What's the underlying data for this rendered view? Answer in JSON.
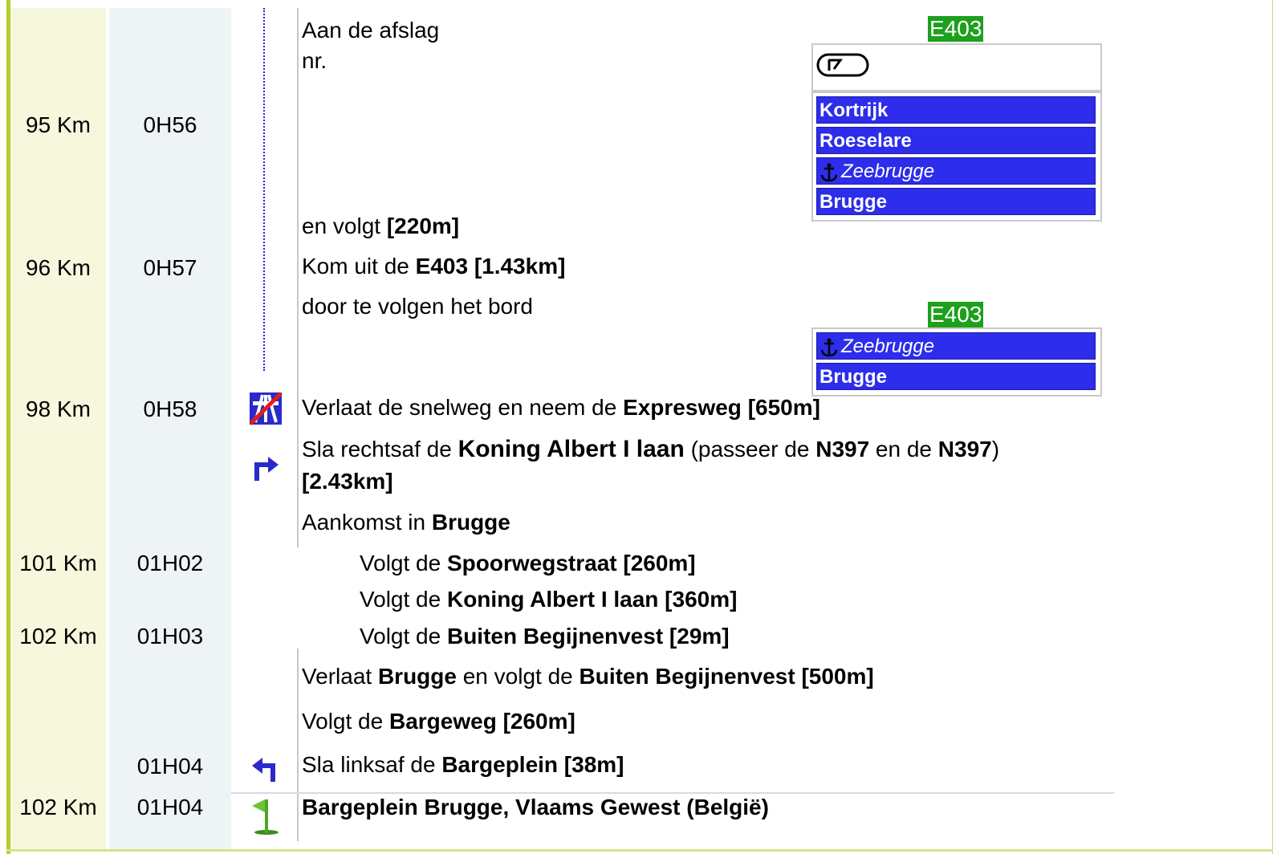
{
  "rows": {
    "r1": {
      "text1": "Aan de afslag",
      "text2": "nr.",
      "km": "95 Km",
      "time": "0H56"
    },
    "r2": {
      "prefix": "en volgt ",
      "bold": "[220m]"
    },
    "r3": {
      "km": "96 Km",
      "time": "0H57",
      "prefix": "Kom uit de ",
      "bold": "E403 [1.43km]"
    },
    "r4": {
      "text": "door te volgen het bord"
    },
    "r5": {
      "km": "98 Km",
      "time": "0H58",
      "prefix": "Verlaat de snelweg en neem de ",
      "bold": "Expresweg [650m]"
    },
    "r6": {
      "prefix": "Sla rechtsaf de ",
      "bold1": "Koning Albert I laan",
      "mid1": " (passeer de ",
      "bold2": "N397",
      "mid2": " en de ",
      "bold3": "N397",
      "end": ")",
      "line2": "[2.43km]"
    },
    "r7": {
      "prefix": "Aankomst in ",
      "bold": "Brugge"
    },
    "r8": {
      "km": "101 Km",
      "time": "01H02",
      "prefix": "Volgt de ",
      "bold": "Spoorwegstraat [260m]"
    },
    "r9": {
      "prefix": "Volgt de ",
      "bold": "Koning Albert I laan [360m]"
    },
    "r10": {
      "km": "102 Km",
      "time": "01H03",
      "prefix": "Volgt de ",
      "bold": "Buiten Begijnenvest [29m]"
    },
    "r11": {
      "prefix": "Verlaat ",
      "bold1": "Brugge",
      "mid": " en volgt de ",
      "bold2": "Buiten Begijnenvest [500m]"
    },
    "r12": {
      "prefix": "Volgt de ",
      "bold": "Bargeweg [260m]"
    },
    "r13": {
      "time": "01H04",
      "prefix": "Sla linksaf de ",
      "bold": "Bargeplein [38m]"
    },
    "r14": {
      "km": "102 Km",
      "time": "01H04",
      "bold": "Bargeplein Brugge, Vlaams Gewest (België)"
    }
  },
  "sign1": {
    "road": "E403",
    "destinations": [
      "Kortrijk",
      "Roeselare",
      "Zeebrugge",
      "Brugge"
    ]
  },
  "sign2": {
    "road": "E403",
    "destinations": [
      "Zeebrugge",
      "Brugge"
    ]
  },
  "colors": {
    "road_green": "#1da01d",
    "dest_blue": "#2d2deb",
    "icon_blue": "#2a2acb",
    "left_bar": "#b5cc2e"
  },
  "icons": [
    "exit-sign-icon",
    "anchor-icon",
    "motorway-end-icon",
    "turn-right-icon",
    "turn-left-icon",
    "finish-flag-icon"
  ]
}
